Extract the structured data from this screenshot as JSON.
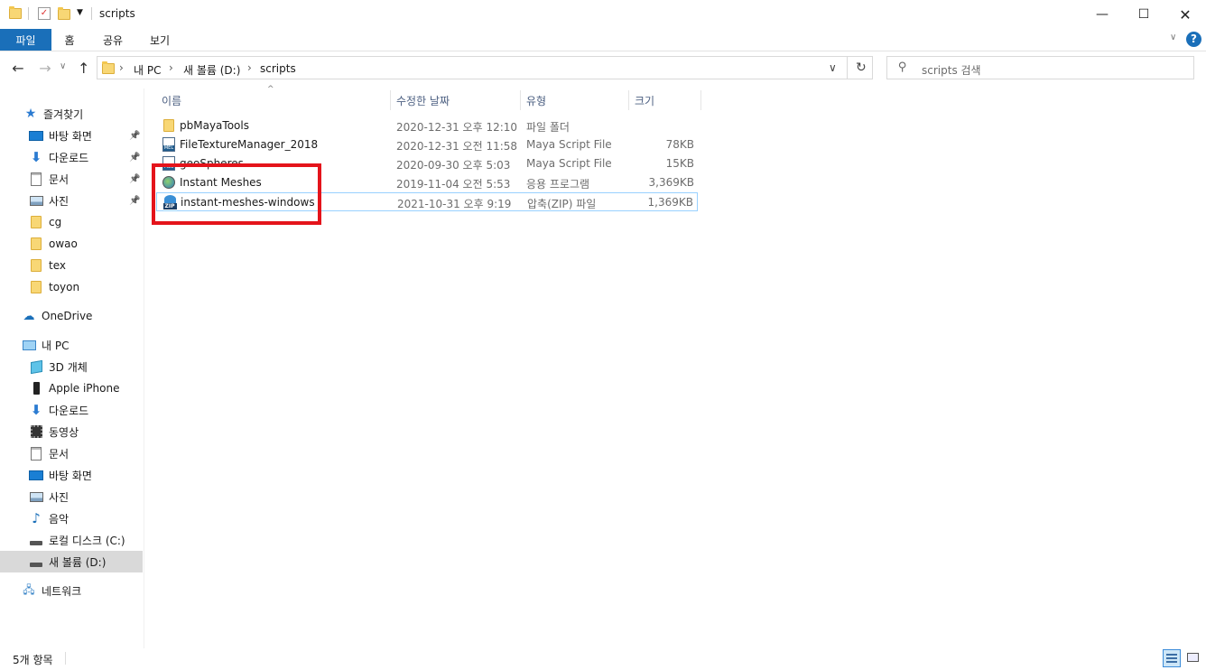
{
  "window": {
    "title": "scripts"
  },
  "ribbon": {
    "tabs": [
      "파일",
      "홈",
      "공유",
      "보기"
    ],
    "help": "?"
  },
  "address": {
    "crumbs": [
      "내 PC",
      "새 볼륨 (D:)",
      "scripts"
    ],
    "search_placeholder": "scripts 검색"
  },
  "sidebar": {
    "quick_access": "즐겨찾기",
    "quick_items": [
      {
        "label": "바탕 화면",
        "icon": "desktop-icon",
        "pinned": true
      },
      {
        "label": "다운로드",
        "icon": "download-icon",
        "pinned": true
      },
      {
        "label": "문서",
        "icon": "document-icon",
        "pinned": true
      },
      {
        "label": "사진",
        "icon": "pictures-icon",
        "pinned": true
      },
      {
        "label": "cg",
        "icon": "folder-icon",
        "pinned": false
      },
      {
        "label": "owao",
        "icon": "folder-icon",
        "pinned": false
      },
      {
        "label": "tex",
        "icon": "folder-icon",
        "pinned": false
      },
      {
        "label": "toyon",
        "icon": "folder-icon",
        "pinned": false
      }
    ],
    "onedrive": "OneDrive",
    "this_pc": "내 PC",
    "pc_items": [
      {
        "label": "3D 개체",
        "icon": "3d-objects-icon"
      },
      {
        "label": "Apple iPhone",
        "icon": "phone-icon"
      },
      {
        "label": "다운로드",
        "icon": "download-icon"
      },
      {
        "label": "동영상",
        "icon": "video-icon"
      },
      {
        "label": "문서",
        "icon": "document-icon"
      },
      {
        "label": "바탕 화면",
        "icon": "desktop-icon"
      },
      {
        "label": "사진",
        "icon": "pictures-icon"
      },
      {
        "label": "음악",
        "icon": "music-icon"
      },
      {
        "label": "로컬 디스크 (C:)",
        "icon": "drive-icon"
      },
      {
        "label": "새 볼륨 (D:)",
        "icon": "drive-icon"
      }
    ],
    "network": "네트워크"
  },
  "columns": [
    "이름",
    "수정한 날짜",
    "유형",
    "크기"
  ],
  "files": [
    {
      "name": "pbMayaTools",
      "date": "2020-12-31 오후 12:10",
      "type": "파일 폴더",
      "size": "",
      "icon": "folder-icon"
    },
    {
      "name": "FileTextureManager_2018",
      "date": "2020-12-31 오전 11:58",
      "type": "Maya Script File",
      "size": "78KB",
      "icon": "mel-file-icon"
    },
    {
      "name": "geoSpheres",
      "date": "2020-09-30 오후 5:03",
      "type": "Maya Script File",
      "size": "15KB",
      "icon": "mel-file-icon"
    },
    {
      "name": "Instant Meshes",
      "date": "2019-11-04 오전 5:53",
      "type": "응용 프로그램",
      "size": "3,369KB",
      "icon": "app-icon"
    },
    {
      "name": "instant-meshes-windows",
      "date": "2021-10-31 오후 9:19",
      "type": "압축(ZIP) 파일",
      "size": "1,369KB",
      "icon": "zip-icon"
    }
  ],
  "status": {
    "count": "5개 항목"
  },
  "colors": {
    "accent": "#1a6fb9",
    "highlight": "#e4141b",
    "selection": "#d9d9d9"
  }
}
